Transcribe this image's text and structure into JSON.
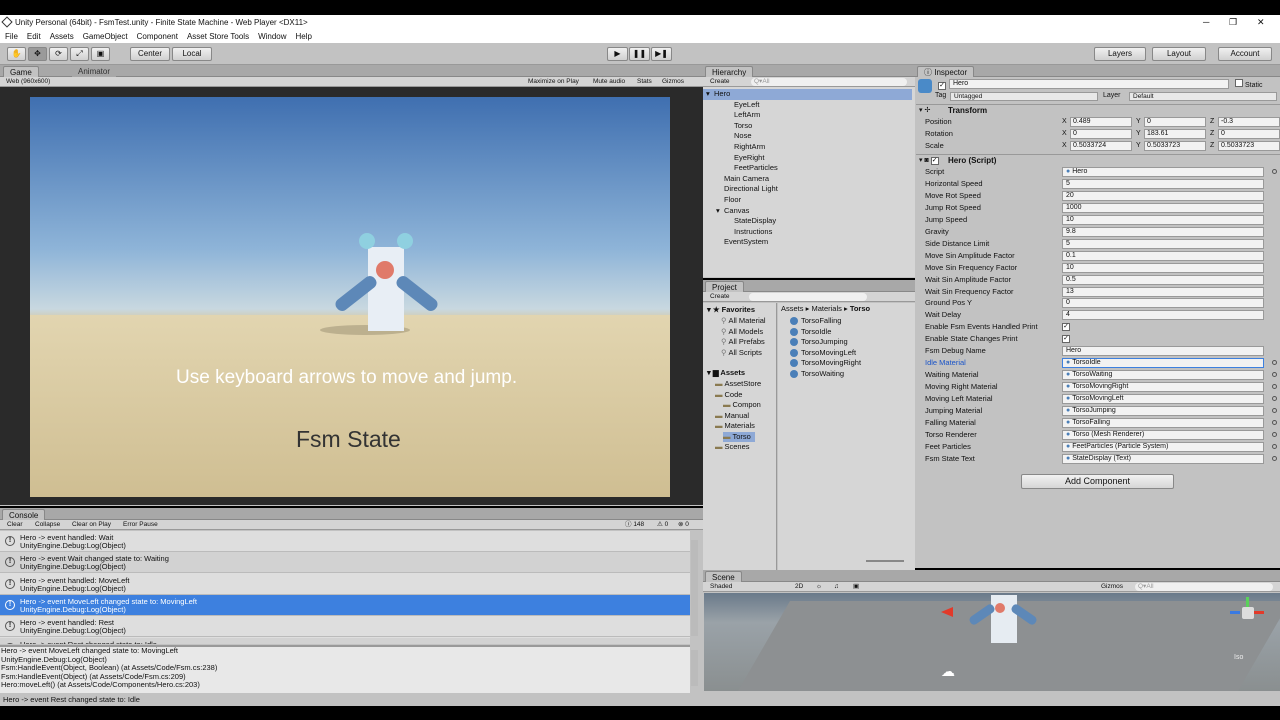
{
  "window": {
    "title": "Unity Personal (64bit) - FsmTest.unity - Finite State Machine - Web Player <DX11>",
    "controls": [
      "─",
      "❐",
      "✕"
    ]
  },
  "menu": [
    "File",
    "Edit",
    "Assets",
    "GameObject",
    "Component",
    "Asset Store Tools",
    "Window",
    "Help"
  ],
  "toolbar": {
    "pivot": "Center",
    "space": "Local",
    "layers": "Layers",
    "layout": "Layout",
    "account": "Account"
  },
  "game_panel": {
    "tab_game": "Game",
    "tab_animator": "Animator",
    "resolution": "Web (960x600)",
    "options": [
      "Maximize on Play",
      "Mute audio",
      "Stats",
      "Gizmos"
    ],
    "instructions": "Use keyboard arrows to move and jump.",
    "state_text": "Fsm State"
  },
  "hierarchy": {
    "tab": "Hierarchy",
    "create": "Create",
    "search_placeholder": "Q▾All",
    "items": [
      {
        "label": "Hero",
        "indent": 0,
        "selected": true
      },
      {
        "label": "EyeLeft",
        "indent": 2
      },
      {
        "label": "LeftArm",
        "indent": 2
      },
      {
        "label": "Torso",
        "indent": 2
      },
      {
        "label": "Nose",
        "indent": 2
      },
      {
        "label": "RightArm",
        "indent": 2
      },
      {
        "label": "EyeRight",
        "indent": 2
      },
      {
        "label": "FeetParticles",
        "indent": 2
      },
      {
        "label": "Main Camera",
        "indent": 1
      },
      {
        "label": "Directional Light",
        "indent": 1
      },
      {
        "label": "Floor",
        "indent": 1
      },
      {
        "label": "Canvas",
        "indent": 1
      },
      {
        "label": "StateDisplay",
        "indent": 2
      },
      {
        "label": "Instructions",
        "indent": 2
      },
      {
        "label": "EventSystem",
        "indent": 1
      }
    ]
  },
  "project": {
    "tab": "Project",
    "create": "Create",
    "breadcrumb": [
      "Assets",
      "Materials",
      "Torso"
    ],
    "favorites_label": "Favorites",
    "favorites": [
      "All Material",
      "All Models",
      "All Prefabs",
      "All Scripts"
    ],
    "assets_label": "Assets",
    "tree": [
      {
        "label": "AssetStore",
        "indent": 1
      },
      {
        "label": "Code",
        "indent": 1
      },
      {
        "label": "Compon",
        "indent": 2
      },
      {
        "label": "Manual",
        "indent": 1
      },
      {
        "label": "Materials",
        "indent": 1
      },
      {
        "label": "Torso",
        "indent": 2,
        "selected": true
      },
      {
        "label": "Scenes",
        "indent": 1
      }
    ],
    "files": [
      "TorsoFalling",
      "TorsoIdle",
      "TorsoJumping",
      "TorsoMovingLeft",
      "TorsoMovingRight",
      "TorsoWaiting"
    ]
  },
  "inspector": {
    "tab": "Inspector",
    "object_name": "Hero",
    "static_label": "Static",
    "tag_label": "Tag",
    "tag_value": "Untagged",
    "layer_label": "Layer",
    "layer_value": "Default",
    "transform_title": "Transform",
    "position": {
      "label": "Position",
      "x": "0.489",
      "y": "0",
      "z": "-0.3"
    },
    "rotation": {
      "label": "Rotation",
      "x": "0",
      "y": "183.61",
      "z": "0"
    },
    "scale": {
      "label": "Scale",
      "x": "0.5033724",
      "y": "0.5033723",
      "z": "0.5033723"
    },
    "script_title": "Hero (Script)",
    "fields": [
      {
        "label": "Script",
        "value": "Hero",
        "obj": true
      },
      {
        "label": "Horizontal Speed",
        "value": "5"
      },
      {
        "label": "Move Rot Speed",
        "value": "20"
      },
      {
        "label": "Jump Rot Speed",
        "value": "1000"
      },
      {
        "label": "Jump Speed",
        "value": "10"
      },
      {
        "label": "Gravity",
        "value": "9.8"
      },
      {
        "label": "Side Distance Limit",
        "value": "5"
      },
      {
        "label": "Move Sin Amplitude Factor",
        "value": "0.1"
      },
      {
        "label": "Move Sin Frequency Factor",
        "value": "10"
      },
      {
        "label": "Wait Sin Amplitude Factor",
        "value": "0.5"
      },
      {
        "label": "Wait Sin Frequency Factor",
        "value": "13"
      },
      {
        "label": "Ground Pos Y",
        "value": "0"
      },
      {
        "label": "Wait Delay",
        "value": "4"
      },
      {
        "label": "Enable Fsm Events Handled Print",
        "value": "✓",
        "check": true
      },
      {
        "label": "Enable State Changes Print",
        "value": "✓",
        "check": true
      },
      {
        "label": "Fsm Debug Name",
        "value": "Hero"
      },
      {
        "label": "Idle Material",
        "value": "TorsoIdle",
        "obj": true,
        "active": true
      },
      {
        "label": "Waiting Material",
        "value": "TorsoWaiting",
        "obj": true
      },
      {
        "label": "Moving Right Material",
        "value": "TorsoMovingRight",
        "obj": true
      },
      {
        "label": "Moving Left Material",
        "value": "TorsoMovingLeft",
        "obj": true
      },
      {
        "label": "Jumping Material",
        "value": "TorsoJumping",
        "obj": true
      },
      {
        "label": "Falling Material",
        "value": "TorsoFalling",
        "obj": true
      },
      {
        "label": "Torso Renderer",
        "value": "Torso (Mesh Renderer)",
        "obj": true
      },
      {
        "label": "Feet Particles",
        "value": "FeetParticles (Particle System)",
        "obj": true
      },
      {
        "label": "Fsm State Text",
        "value": "StateDisplay (Text)",
        "obj": true
      }
    ],
    "add_component": "Add Component"
  },
  "console": {
    "tab": "Console",
    "buttons": [
      "Clear",
      "Collapse",
      "Clear on Play",
      "Error Pause"
    ],
    "counts": {
      "info": "148",
      "warn": "0",
      "error": "0"
    },
    "rows": [
      {
        "l1": "Hero -> event handled: Wait",
        "l2": "UnityEngine.Debug:Log(Object)"
      },
      {
        "l1": "Hero -> event Wait changed state to: Waiting",
        "l2": "UnityEngine.Debug:Log(Object)"
      },
      {
        "l1": "Hero -> event handled: MoveLeft",
        "l2": "UnityEngine.Debug:Log(Object)"
      },
      {
        "l1": "Hero -> event MoveLeft changed state to: MovingLeft",
        "l2": "UnityEngine.Debug:Log(Object)",
        "selected": true
      },
      {
        "l1": "Hero -> event handled: Rest",
        "l2": "UnityEngine.Debug:Log(Object)"
      },
      {
        "l1": "Hero -> event Rest changed state to: Idle",
        "l2": ""
      }
    ],
    "detail": [
      "Hero -> event MoveLeft changed state to: MovingLeft",
      "UnityEngine.Debug:Log(Object)",
      "Fsm:HandleEvent(Object, Boolean) (at Assets/Code/Fsm.cs:238)",
      "Fsm:HandleEvent(Object) (at Assets/Code/Fsm.cs:209)",
      "Hero:moveLeft() (at Assets/Code/Components/Hero.cs:203)"
    ],
    "status": "Hero -> event Rest changed state to: Idle"
  },
  "scene": {
    "tab": "Scene",
    "shading": "Shaded",
    "mode_2d": "2D",
    "gizmos": "Gizmos",
    "search_placeholder": "Q▾All",
    "persp": "Iso"
  },
  "colors": {
    "selection": "#3d80df",
    "panel": "#c2c2c2",
    "tab": "#a8a8a8"
  }
}
